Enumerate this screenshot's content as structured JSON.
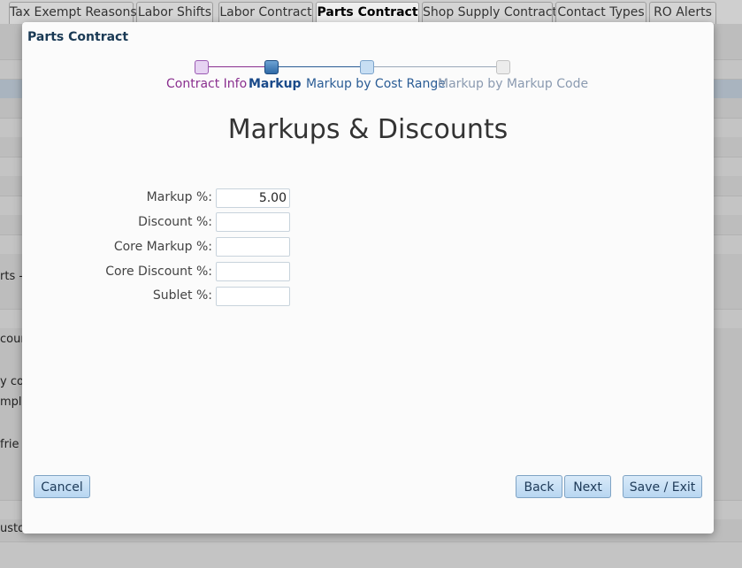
{
  "tabs": [
    {
      "label": "Tax Exempt Reasons"
    },
    {
      "label": "Labor Shifts"
    },
    {
      "label": "Labor Contract"
    },
    {
      "label": "Parts Contract"
    },
    {
      "label": "Shop Supply Contract"
    },
    {
      "label": "Contact Types"
    },
    {
      "label": "RO Alerts"
    }
  ],
  "background_text": [
    "rts -",
    "coun",
    "y co",
    "mplo",
    "frie",
    "usto"
  ],
  "modal": {
    "title": "Parts Contract",
    "steps": [
      {
        "label": "Contract Info",
        "state": "completed",
        "color": "#8a2f8f"
      },
      {
        "label": "Markup",
        "state": "current",
        "color": "#1a4a8a"
      },
      {
        "label": "Markup by Cost Range",
        "state": "upcoming",
        "color": "#2a5c95"
      },
      {
        "label": "Markup by Markup Code",
        "state": "disabled",
        "color": "#8a9ab0"
      }
    ],
    "heading": "Markups & Discounts",
    "fields": [
      {
        "label": "Markup %:",
        "value": "5.00"
      },
      {
        "label": "Discount %:",
        "value": ""
      },
      {
        "label": "Core Markup %:",
        "value": ""
      },
      {
        "label": "Core Discount %:",
        "value": ""
      },
      {
        "label": "Sublet %:",
        "value": ""
      }
    ],
    "buttons": {
      "cancel": "Cancel",
      "back": "Back",
      "next": "Next",
      "save_exit": "Save / Exit"
    }
  }
}
